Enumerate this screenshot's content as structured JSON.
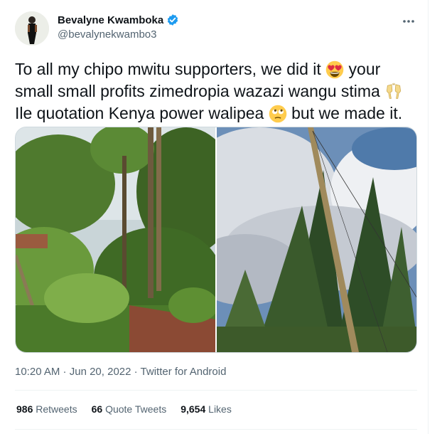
{
  "author": {
    "display_name": "Bevalyne Kwamboka",
    "handle": "@bevalynekwambo3",
    "verified_badge_icon": "verified-badge-icon",
    "verified_color": "#1d9bf0"
  },
  "more_icon": "more-dots-icon",
  "tweet": {
    "line1_a": "To all my chipo mwitu supporters, we did it",
    "line1_b": " your",
    "line2": "small small profits zimedropia wazazi wangu stima",
    "line3_a": "Ile quotation Kenya power walipea",
    "line3_b": " but we made it.",
    "emojis": [
      "heart-eyes-emoji",
      "clinking-glasses-emoji",
      "rolling-eyes-emoji"
    ]
  },
  "media": {
    "photos": [
      "photo-trees-and-pole-clearing",
      "photo-power-pole-sky"
    ]
  },
  "meta": {
    "time": "10:20 AM",
    "sep1": " · ",
    "date": "Jun 20, 2022",
    "sep2": " · ",
    "source": "Twitter for Android"
  },
  "stats": {
    "retweets_count": "986",
    "retweets_label": "Retweets",
    "quotes_count": "66",
    "quotes_label": "Quote Tweets",
    "likes_count": "9,654",
    "likes_label": "Likes"
  }
}
